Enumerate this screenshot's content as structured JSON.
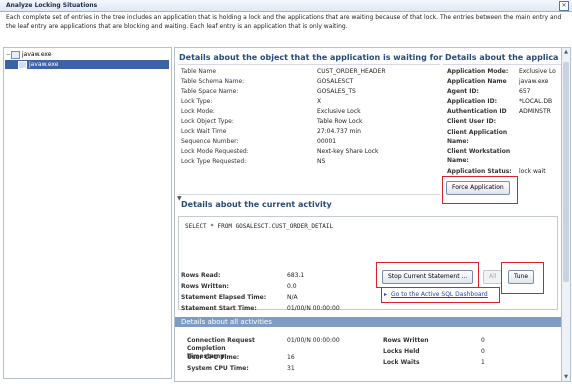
{
  "window": {
    "title": "Analyze Locking Situations"
  },
  "description": "Each complete set of entries in the tree includes an application that is holding a lock and the applications that are waiting because of that lock. The entries between the main entry and the leaf entry are applications that are blocking and waiting. Each leaf entry is an application that is only waiting.",
  "tree": {
    "items": [
      {
        "label": "javaw.exe"
      },
      {
        "label": "javaw.exe"
      }
    ]
  },
  "waiting": {
    "title": "Details about the object that the application is waiting for",
    "rows": [
      {
        "label": "Table Name",
        "value": "CUST_ORDER_HEADER"
      },
      {
        "label": "Table Schema Name:",
        "value": "GOSALESCT"
      },
      {
        "label": "Table Space Name:",
        "value": "GOSALES_TS"
      },
      {
        "label": "Lock Type:",
        "value": "X"
      },
      {
        "label": "Lock Mode:",
        "value": "Exclusive Lock"
      },
      {
        "label": "Lock Object Type:",
        "value": "Table Row Lock"
      },
      {
        "label": "Lock Wait Time",
        "value": "27:04.737 min"
      },
      {
        "label": "Sequence Number:",
        "value": "00001"
      },
      {
        "label": "Lock Mode Requested:",
        "value": "Next-key Share Lock"
      },
      {
        "label": "Lock Type Requested:",
        "value": "NS"
      }
    ]
  },
  "application": {
    "title": "Details about the applica",
    "rows": [
      {
        "label": "Application Mode:",
        "value": "Exclusive Lo"
      },
      {
        "label": "Application Name",
        "value": "javaw.exe"
      },
      {
        "label": "Agent ID:",
        "value": "657"
      },
      {
        "label": "Application ID:",
        "value": "*LOCAL.DB"
      },
      {
        "label": "Authentication ID",
        "value": "ADMINSTR"
      },
      {
        "label": "Client User ID:",
        "value": ""
      },
      {
        "label": "Client Application Name:",
        "value": ""
      },
      {
        "label": "Client Workstation Name:",
        "value": ""
      },
      {
        "label": "Application Status:",
        "value": "lock wait"
      }
    ],
    "force_label": "Force Application"
  },
  "activity": {
    "title": "Details about the current activity",
    "sql": "SELECT * FROM GOSALESCT.CUST_ORDER_DETAIL",
    "stats": [
      {
        "label": "Rows Read:",
        "value": "683.1"
      },
      {
        "label": "Rows Written:",
        "value": "0.0"
      },
      {
        "label": "Statement Elapsed Time:",
        "value": "N/A"
      },
      {
        "label": "Statement Start Time:",
        "value": "01/00/N 00:00:00"
      }
    ],
    "stop_label": "Stop Current Statement ...",
    "all_label": "All",
    "tune_label": "Tune",
    "link_label": "Go to the Active SQL Dashboard"
  },
  "uow": {
    "title": "Details about all activities",
    "left": [
      {
        "label": "Connection Request Completion Timestamp:",
        "value": "01/00/N 00:00:00"
      },
      {
        "label": "User CPU Time:",
        "value": "16"
      },
      {
        "label": "System CPU Time:",
        "value": "31"
      }
    ],
    "right": [
      {
        "label": "Rows Written",
        "value": "0"
      },
      {
        "label": "Locks Held",
        "value": "0"
      },
      {
        "label": "Lock Waits",
        "value": "1"
      }
    ]
  },
  "colors": {
    "accent": "#3c63a4",
    "highlight": "#d8232a"
  }
}
